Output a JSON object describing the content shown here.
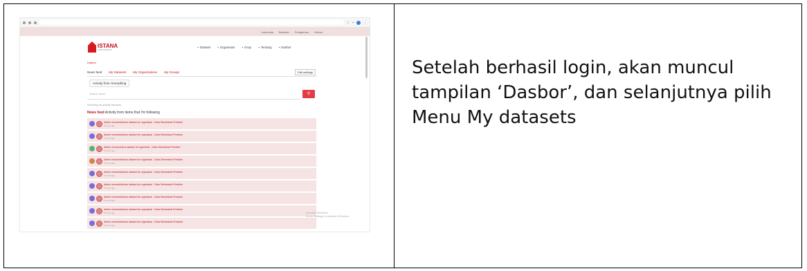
{
  "caption": {
    "lines": [
      "Setelah berhasil login, akan muncul",
      "tampilan ‘Dasbor’, dan selanjutnya pilih",
      "Menu My datasets"
    ]
  },
  "screenshot": {
    "topbar": {
      "items": [
        "Indonesia",
        "Bantuan",
        "Pengaturan",
        "Keluar"
      ]
    },
    "logo": {
      "name": "ISTANA",
      "sub": "INDONESIA"
    },
    "nav": [
      "Dataset",
      "Organisasi",
      "Grup",
      "Tentang",
      "Dasbor"
    ],
    "breadcrumb": "Dasbor",
    "tabs": [
      "News feed",
      "My Datasets",
      "My Organizations",
      "My Groups"
    ],
    "tab_right": "Edit settings",
    "activity_button": "Activity from: Everything",
    "search_placeholder": "Search news",
    "recent_line": "Showing all activity streams",
    "news_title_bold": "News feed",
    "news_title_rest": "Activity from items that I'm following",
    "rows": [
      {
        "text": "Admin menambahkan dataset ke organisasi - Data Sekretariat Presiden",
        "time": "2 hours ago",
        "color": "#7b6cd6"
      },
      {
        "text": "Admin menambahkan dataset ke organisasi - Data Sekretariat Presiden",
        "time": "2 hours ago",
        "color": "#7b6cd6"
      },
      {
        "text": "Admin memperbarui dataset di organisasi - Data Sekretariat Presiden",
        "time": "3 hours ago",
        "color": "#5ab07a"
      },
      {
        "text": "Admin menambahkan dataset ke organisasi - Data Sekretariat Presiden",
        "time": "3 hours ago",
        "color": "#c98a46"
      },
      {
        "text": "Admin menambahkan dataset ke organisasi - Data Sekretariat Presiden",
        "time": "4 hours ago",
        "color": "#7b6cd6"
      },
      {
        "text": "Admin menambahkan dataset ke organisasi - Data Sekretariat Presiden",
        "time": "4 hours ago",
        "color": "#7b6cd6"
      },
      {
        "text": "Admin menambahkan dataset ke organisasi - Data Sekretariat Presiden",
        "time": "5 hours ago",
        "color": "#7b6cd6"
      },
      {
        "text": "Admin menambahkan dataset ke organisasi - Data Sekretariat Presiden",
        "time": "5 hours ago",
        "color": "#7b6cd6"
      },
      {
        "text": "Admin menambahkan dataset ke organisasi - Data Sekretariat Presiden",
        "time": "6 hours ago",
        "color": "#7b6cd6"
      }
    ],
    "watermark": [
      "Activate Windows",
      "Go to Settings to activate Windows."
    ]
  }
}
